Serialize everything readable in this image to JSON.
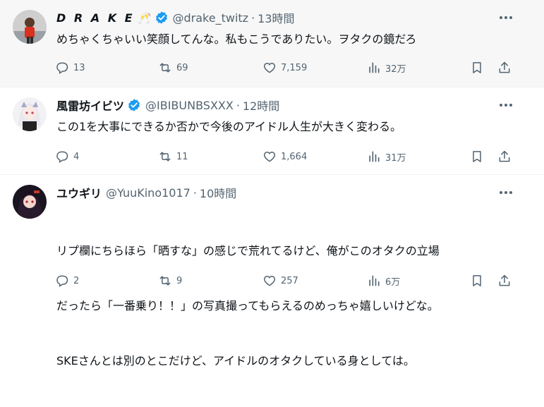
{
  "tweets": [
    {
      "name": "D R A K E",
      "name_emoji": "🥂",
      "handle": "@drake_twitz",
      "dot": "·",
      "time": "13時間",
      "text": "めちゃくちゃいい笑顔してんな。私もこうでありたい。ヲタクの鏡だろ",
      "replies": "13",
      "retweets": "69",
      "likes": "7,159",
      "views": "32万",
      "verified": true
    },
    {
      "name": "風雷坊イビツ",
      "handle": "@IBIBUNBSXXX",
      "dot": "·",
      "time": "12時間",
      "text": "この1を大事にできるか否かで今後のアイドル人生が大きく変わる。",
      "replies": "4",
      "retweets": "11",
      "likes": "1,664",
      "views": "31万",
      "verified": true
    },
    {
      "name": "ユウギリ",
      "handle": "@YuuKino1017",
      "dot": "·",
      "time": "10時間",
      "text_lines": [
        "リプ欄にちらほら「晒すな」の感じで荒れてるけど、俺がこのオタクの立場",
        "だったら「一番乗り！！」の写真撮ってもらえるのめっちゃ嬉しいけどな。",
        "SKEさんとは別のとこだけど、アイドルのオタクしている身としては。"
      ],
      "replies": "2",
      "retweets": "9",
      "likes": "257",
      "views": "6万",
      "verified": false
    }
  ],
  "icons": {
    "reply": "reply-bubble-icon",
    "retweet": "retweet-arrows-icon",
    "like": "heart-icon",
    "views": "bar-chart-icon",
    "bookmark": "bookmark-icon",
    "share": "share-upload-icon",
    "more": "more-dots-icon",
    "verified": "verified-badge-icon"
  },
  "colors": {
    "verified": "#1d9bf0",
    "muted": "#536471",
    "text": "#0f1419"
  }
}
